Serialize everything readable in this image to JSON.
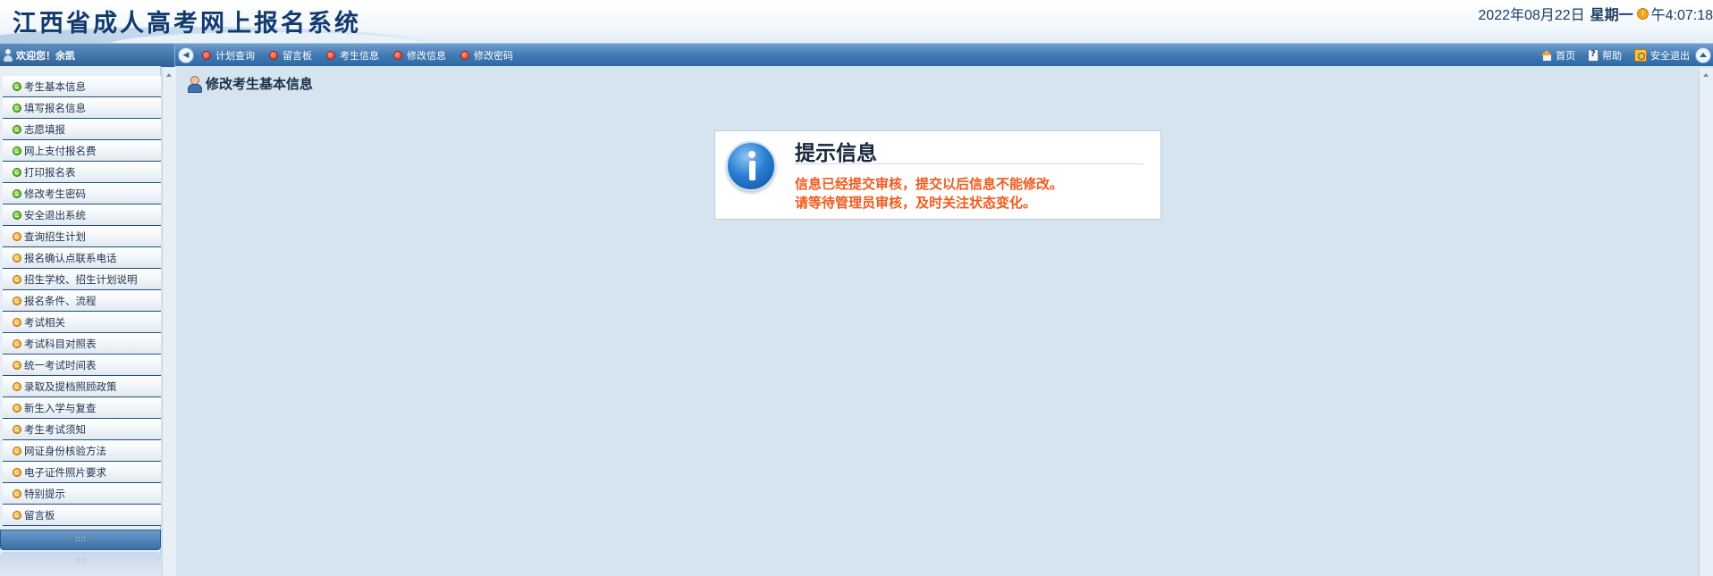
{
  "header": {
    "site_title": "江西省成人高考网上报名系统",
    "date": "2022年08月22日",
    "weekday": "星期一",
    "time": "午4:07:18"
  },
  "topbar": {
    "welcome": "欢迎您！余凯",
    "nav": [
      "计划查询",
      "留言板",
      "考生信息",
      "修改信息",
      "修改密码"
    ],
    "home": "首页",
    "help": "帮助",
    "logout": "安全退出"
  },
  "sidebar": {
    "items": [
      {
        "label": "考生基本信息",
        "icon": "green-dot-icon"
      },
      {
        "label": "填写报名信息",
        "icon": "green-dot-icon"
      },
      {
        "label": "志愿填报",
        "icon": "green-dot-icon"
      },
      {
        "label": "网上支付报名费",
        "icon": "green-dot-icon"
      },
      {
        "label": "打印报名表",
        "icon": "green-dot-icon"
      },
      {
        "label": "修改考生密码",
        "icon": "green-dot-icon"
      },
      {
        "label": "安全退出系统",
        "icon": "green-dot-icon"
      },
      {
        "label": "查询招生计划",
        "icon": "orange-dot-icon"
      },
      {
        "label": "报名确认点联系电话",
        "icon": "orange-dot-icon"
      },
      {
        "label": "招生学校、招生计划说明",
        "icon": "orange-dot-icon"
      },
      {
        "label": "报名条件、流程",
        "icon": "orange-dot-icon"
      },
      {
        "label": "考试相关",
        "icon": "orange-dot-icon"
      },
      {
        "label": "考试科目对照表",
        "icon": "orange-dot-icon"
      },
      {
        "label": "统一考试时间表",
        "icon": "orange-dot-icon"
      },
      {
        "label": "录取及提档照顾政策",
        "icon": "orange-dot-icon"
      },
      {
        "label": "新生入学与复查",
        "icon": "orange-dot-icon"
      },
      {
        "label": "考生考试须知",
        "icon": "orange-dot-icon"
      },
      {
        "label": "网证身份核验方法",
        "icon": "orange-dot-icon"
      },
      {
        "label": "电子证件照片要求",
        "icon": "orange-dot-icon"
      },
      {
        "label": "特别提示",
        "icon": "orange-dot-icon"
      },
      {
        "label": "留言板",
        "icon": "orange-dot-icon"
      }
    ]
  },
  "main": {
    "heading": "修改考生基本信息",
    "info": {
      "title": "提示信息",
      "line1": "信息已经提交审核，提交以后信息不能修改。",
      "line2": "请等待管理员审核，及时关注状态变化。"
    }
  },
  "colors": {
    "topbar": "#3f77b1",
    "background": "#d6e4f0",
    "message": "#f05a1c"
  }
}
